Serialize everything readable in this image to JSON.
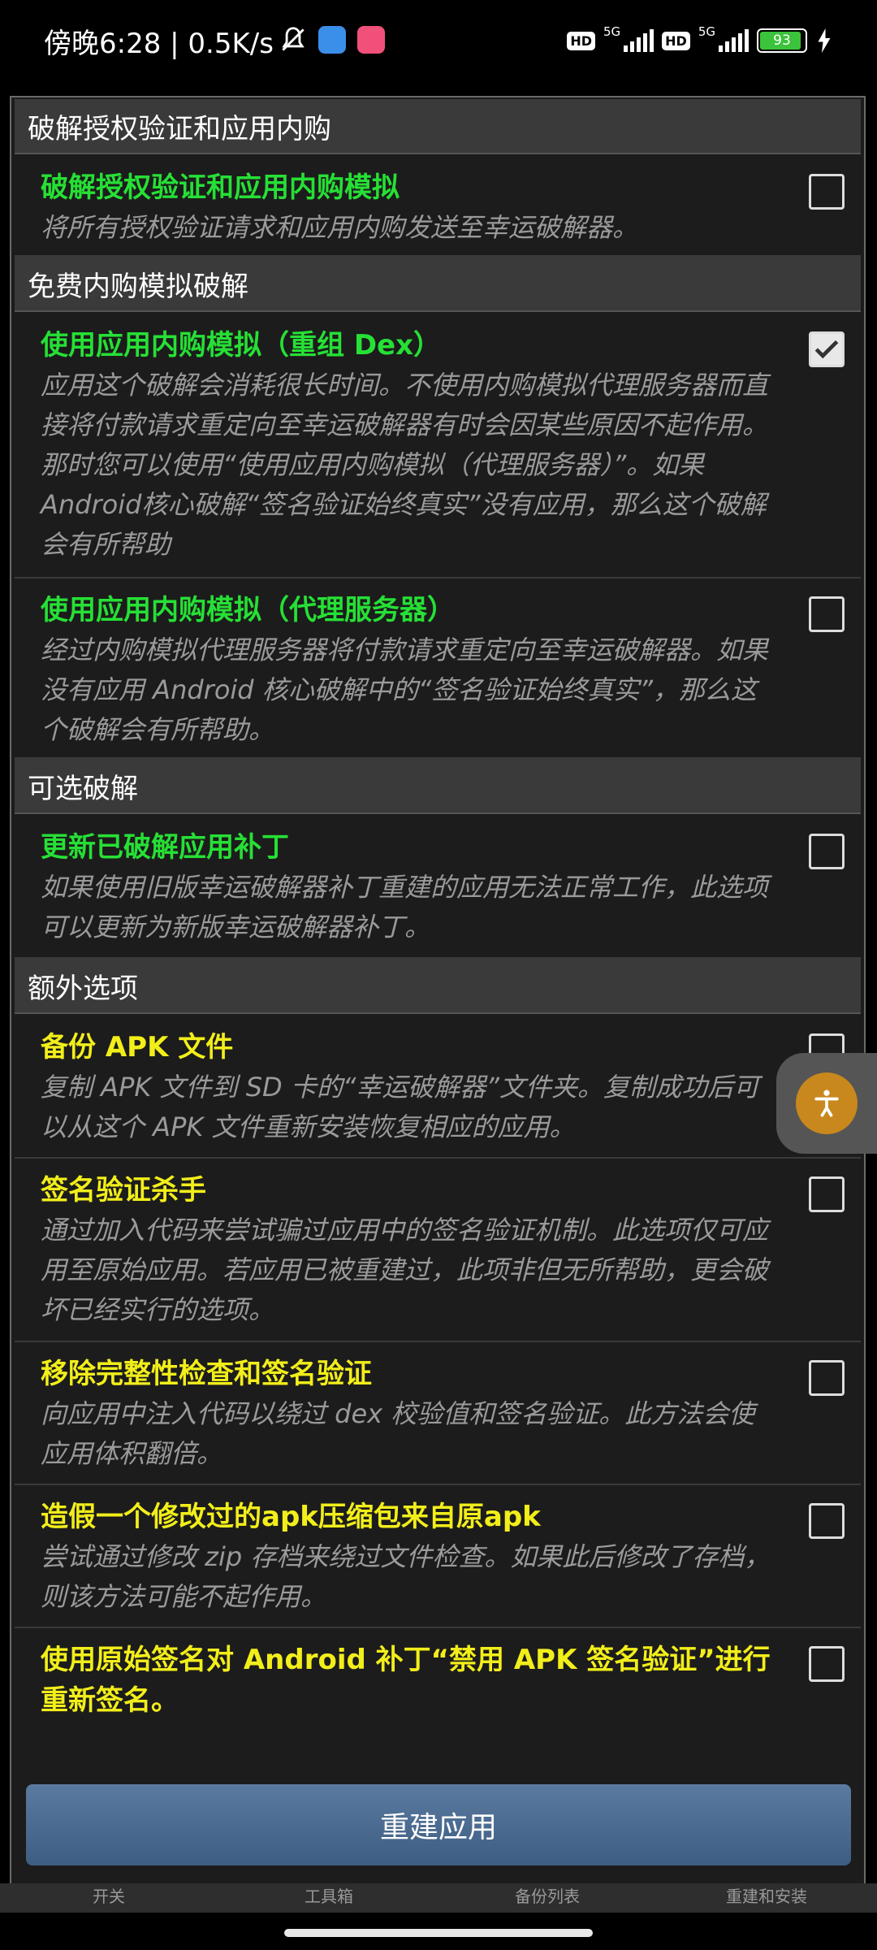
{
  "status_bar": {
    "time": "傍晚6:28 | 0.5K/s",
    "signal_label": "5G",
    "battery": "93"
  },
  "sections": {
    "license": "破解授权验证和应用内购",
    "iap": "免费内购模拟破解",
    "optional": "可选破解",
    "extra": "额外选项"
  },
  "items": [
    {
      "title": "破解授权验证和应用内购模拟",
      "desc": "将所有授权验证请求和应用内购发送至幸运破解器。",
      "checked": false
    },
    {
      "title": "使用应用内购模拟（重组 Dex）",
      "desc": "应用这个破解会消耗很长时间。不使用内购模拟代理服务器而直接将付款请求重定向至幸运破解器有时会因某些原因不起作用。那时您可以使用“使用应用内购模拟（代理服务器）”。如果Android核心破解“签名验证始终真实”没有应用，那么这个破解会有所帮助",
      "checked": true
    },
    {
      "title": "使用应用内购模拟（代理服务器）",
      "desc": "经过内购模拟代理服务器将付款请求重定向至幸运破解器。如果没有应用 Android 核心破解中的“签名验证始终真实”，那么这个破解会有所帮助。",
      "checked": false
    },
    {
      "title": "更新已破解应用补丁",
      "desc": "如果使用旧版幸运破解器补丁重建的应用无法正常工作，此选项可以更新为新版幸运破解器补丁。",
      "checked": false
    },
    {
      "title": "备份 APK 文件",
      "desc": "复制 APK 文件到 SD 卡的“幸运破解器”文件夹。复制成功后可以从这个 APK 文件重新安装恢复相应的应用。",
      "checked": false
    },
    {
      "title": "签名验证杀手",
      "desc": "通过加入代码来尝试骗过应用中的签名验证机制。此选项仅可应用至原始应用。若应用已被重建过，此项非但无所帮助，更会破坏已经实行的选项。",
      "checked": false
    },
    {
      "title": "移除完整性检查和签名验证",
      "desc": "向应用中注入代码以绕过 dex 校验值和签名验证。此方法会使应用体积翻倍。",
      "checked": false
    },
    {
      "title": "造假一个修改过的apk压缩包来自原apk",
      "desc": "尝试通过修改 zip 存档来绕过文件检查。如果此后修改了存档，则该方法可能不起作用。",
      "checked": false
    },
    {
      "title": "使用原始签名对 Android 补丁“禁用 APK 签名验证”进行重新签名。",
      "desc": "",
      "checked": false
    }
  ],
  "rebuild_button": "重建应用",
  "bottom_tabs": [
    "开关",
    "工具箱",
    "备份列表",
    "重建和安装"
  ]
}
